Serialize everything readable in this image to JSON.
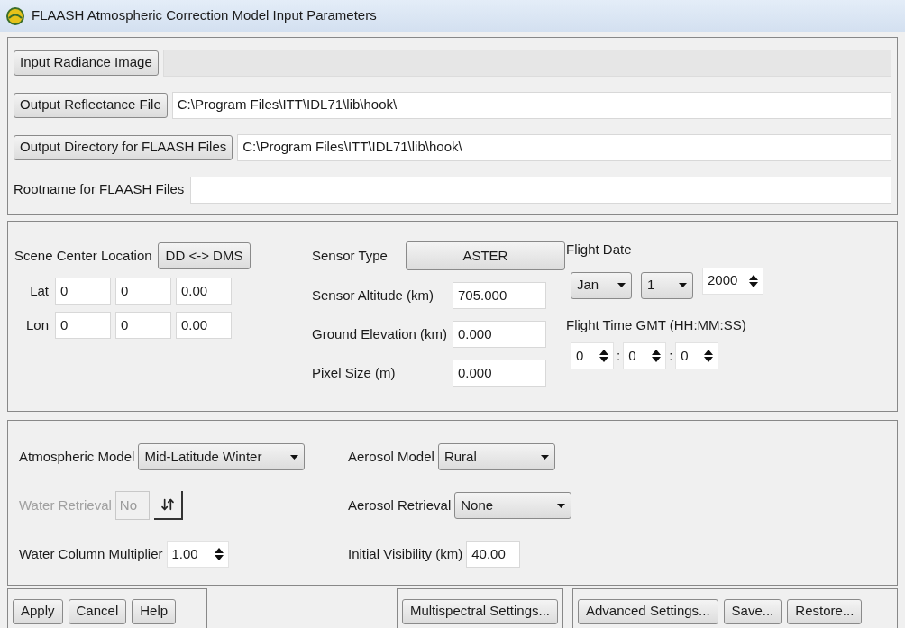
{
  "window": {
    "title": "FLAASH Atmospheric Correction Model Input Parameters"
  },
  "files": [
    {
      "kind": "button",
      "label": "Input Radiance Image",
      "disabled": true
    },
    {
      "kind": "button",
      "label": "Output Reflectance File",
      "value": "C:\\Program Files\\ITT\\IDL71\\lib\\hook\\",
      "disabled": false
    },
    {
      "kind": "button",
      "label": "Output Directory for FLAASH Files",
      "value": "C:\\Program Files\\ITT\\IDL71\\lib\\hook\\",
      "disabled": false
    },
    {
      "kind": "label",
      "label": "Rootname for FLAASH Files",
      "disabled": false
    }
  ],
  "scene": {
    "label": "Scene Center Location",
    "toggle_button": "DD <-> DMS",
    "rows": [
      {
        "label": "Lat",
        "values": [
          "0",
          "0",
          "0.00"
        ]
      },
      {
        "label": "Lon",
        "values": [
          "0",
          "0",
          "0.00"
        ]
      }
    ]
  },
  "sensor": {
    "type_label": "Sensor Type",
    "type_button": "ASTER",
    "fields": [
      {
        "label": "Sensor Altitude (km)",
        "value": "705.000"
      },
      {
        "label": "Ground Elevation (km)",
        "value": "0.000"
      },
      {
        "label": "Pixel Size (m)",
        "value": "0.000"
      }
    ]
  },
  "flight": {
    "date_label": "Flight Date",
    "month": "Jan",
    "day": "1",
    "year": "2000",
    "time_label": "Flight Time GMT (HH:MM:SS)",
    "time": [
      "0",
      "0",
      "0"
    ],
    "separator": ":"
  },
  "atmosphere": {
    "left": [
      {
        "kind": "dropdown",
        "label": "Atmospheric Model",
        "value": "Mid-Latitude Winter",
        "disabled": false
      },
      {
        "kind": "toggle",
        "label": "Water Retrieval",
        "value": "No",
        "disabled": true
      },
      {
        "kind": "spinner",
        "label": "Water Column Multiplier",
        "value": "1.00",
        "disabled": false
      }
    ],
    "right": [
      {
        "kind": "dropdown",
        "label": "Aerosol Model",
        "value": "Rural",
        "disabled": false
      },
      {
        "kind": "dropdown",
        "label": "Aerosol Retrieval",
        "value": "None",
        "disabled": false
      },
      {
        "kind": "field",
        "label": "Initial Visibility (km)",
        "value": "40.00",
        "disabled": false
      }
    ]
  },
  "button_groups": [
    [
      "Apply",
      "Cancel",
      "Help"
    ],
    [
      "Multispectral Settings..."
    ],
    [
      "Advanced Settings...",
      "Save...",
      "Restore..."
    ]
  ]
}
